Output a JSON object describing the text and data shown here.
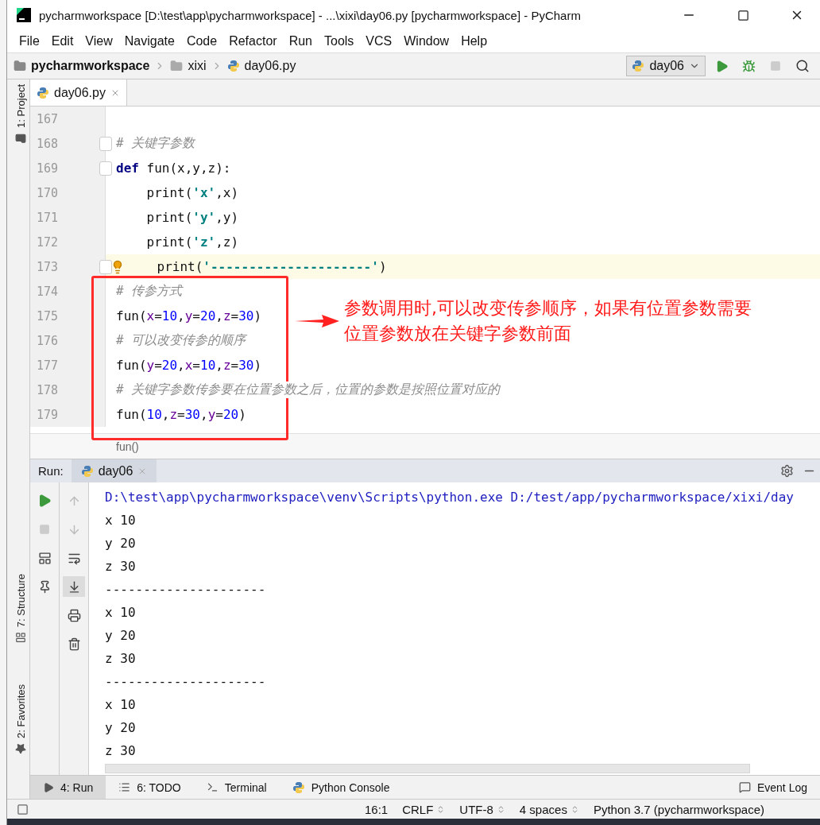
{
  "window": {
    "title": "pycharmworkspace [D:\\test\\app\\pycharmworkspace] - ...\\xixi\\day06.py [pycharmworkspace] - PyCharm"
  },
  "menu": [
    "File",
    "Edit",
    "View",
    "Navigate",
    "Code",
    "Refactor",
    "Run",
    "Tools",
    "VCS",
    "Window",
    "Help"
  ],
  "breadcrumbs": [
    {
      "label": "pycharmworkspace",
      "kind": "project"
    },
    {
      "label": "xixi",
      "kind": "folder"
    },
    {
      "label": "day06.py",
      "kind": "file"
    }
  ],
  "run_config": {
    "label": "day06"
  },
  "editor_tabs": [
    {
      "label": "day06.py",
      "selected": true
    }
  ],
  "side_tools": [
    {
      "label": "1: Project",
      "kind": "project"
    },
    {
      "label": "7: Structure",
      "kind": "structure"
    },
    {
      "label": "2: Favorites",
      "kind": "favorites"
    }
  ],
  "editor": {
    "lines": [
      {
        "number": "167",
        "current": false
      },
      {
        "number": "168",
        "current": false,
        "fold": true,
        "tokens": [
          {
            "text": "# 关键字参数",
            "kind": "comment"
          }
        ]
      },
      {
        "number": "169",
        "current": false,
        "fold": true,
        "tokens": [
          {
            "text": "def",
            "kind": "keyword"
          },
          {
            "text": " fun(x,y,z):",
            "kind": "plain"
          }
        ]
      },
      {
        "number": "170",
        "current": false,
        "tokens": [
          {
            "text": "    print(",
            "kind": "plain"
          },
          {
            "text": "'x'",
            "kind": "string"
          },
          {
            "text": ",x)",
            "kind": "plain"
          }
        ]
      },
      {
        "number": "171",
        "current": false,
        "tokens": [
          {
            "text": "    print(",
            "kind": "plain"
          },
          {
            "text": "'y'",
            "kind": "string"
          },
          {
            "text": ",y)",
            "kind": "plain"
          }
        ]
      },
      {
        "number": "172",
        "current": false,
        "tokens": [
          {
            "text": "    print(",
            "kind": "plain"
          },
          {
            "text": "'z'",
            "kind": "string"
          },
          {
            "text": ",z)",
            "kind": "plain"
          }
        ]
      },
      {
        "number": "173",
        "current": true,
        "fold": true,
        "bulb": true,
        "tokens": [
          {
            "text": "    print(",
            "kind": "plain"
          },
          {
            "text": "'---------------------'",
            "kind": "string"
          },
          {
            "text": ")",
            "kind": "plain"
          }
        ]
      },
      {
        "number": "174",
        "current": false,
        "tokens": [
          {
            "text": "# 传参方式",
            "kind": "comment"
          }
        ]
      },
      {
        "number": "175",
        "current": false,
        "tokens": [
          {
            "text": "fun(",
            "kind": "plain"
          },
          {
            "text": "x",
            "kind": "param"
          },
          {
            "text": "=",
            "kind": "plain"
          },
          {
            "text": "10",
            "kind": "number"
          },
          {
            "text": ",",
            "kind": "plain"
          },
          {
            "text": "y",
            "kind": "param"
          },
          {
            "text": "=",
            "kind": "plain"
          },
          {
            "text": "20",
            "kind": "number"
          },
          {
            "text": ",",
            "kind": "plain"
          },
          {
            "text": "z",
            "kind": "param"
          },
          {
            "text": "=",
            "kind": "plain"
          },
          {
            "text": "30",
            "kind": "number"
          },
          {
            "text": ")",
            "kind": "plain"
          }
        ]
      },
      {
        "number": "176",
        "current": false,
        "tokens": [
          {
            "text": "# 可以改变传参的顺序",
            "kind": "comment"
          }
        ]
      },
      {
        "number": "177",
        "current": false,
        "tokens": [
          {
            "text": "fun(",
            "kind": "plain"
          },
          {
            "text": "y",
            "kind": "param"
          },
          {
            "text": "=",
            "kind": "plain"
          },
          {
            "text": "20",
            "kind": "number"
          },
          {
            "text": ",",
            "kind": "plain"
          },
          {
            "text": "x",
            "kind": "param"
          },
          {
            "text": "=",
            "kind": "plain"
          },
          {
            "text": "10",
            "kind": "number"
          },
          {
            "text": ",",
            "kind": "plain"
          },
          {
            "text": "z",
            "kind": "param"
          },
          {
            "text": "=",
            "kind": "plain"
          },
          {
            "text": "30",
            "kind": "number"
          },
          {
            "text": ")",
            "kind": "plain"
          }
        ]
      },
      {
        "number": "178",
        "current": false,
        "tokens": [
          {
            "text": "# 关键字参数传参要在位置参数之后，位置的参数是按照位置对应的",
            "kind": "comment"
          }
        ]
      },
      {
        "number": "179",
        "current": false,
        "tokens": [
          {
            "text": "fun(",
            "kind": "plain"
          },
          {
            "text": "10",
            "kind": "number"
          },
          {
            "text": ",",
            "kind": "plain"
          },
          {
            "text": "z",
            "kind": "param"
          },
          {
            "text": "=",
            "kind": "plain"
          },
          {
            "text": "30",
            "kind": "number"
          },
          {
            "text": ",",
            "kind": "plain"
          },
          {
            "text": "y",
            "kind": "param"
          },
          {
            "text": "=",
            "kind": "plain"
          },
          {
            "text": "20",
            "kind": "number"
          },
          {
            "text": ")",
            "kind": "plain"
          }
        ]
      }
    ],
    "breadcrumb": "fun()"
  },
  "annotation": {
    "lines": [
      "参数调用时,可以改变传参顺序，如果有位置参数需要",
      "位置参数放在关键字参数前面"
    ]
  },
  "run": {
    "title": "Run:",
    "tabs": [
      {
        "label": "day06",
        "selected": true
      }
    ],
    "output": [
      "D:\\test\\app\\pycharmworkspace\\venv\\Scripts\\python.exe D:/test/app/pycharmworkspace/xixi/day",
      "x 10",
      "y 20",
      "z 30",
      "---------------------",
      "x 10",
      "y 20",
      "z 30",
      "---------------------",
      "x 10",
      "y 20",
      "z 30"
    ]
  },
  "bottom_tabs": [
    {
      "label": "4: Run",
      "kind": "run",
      "selected": true
    },
    {
      "label": "6: TODO",
      "kind": "todo",
      "selected": false
    },
    {
      "label": "Terminal",
      "kind": "terminal",
      "selected": false
    },
    {
      "label": "Python Console",
      "kind": "python",
      "selected": false
    }
  ],
  "event_log": "Event Log",
  "status": [
    "16:1",
    "CRLF",
    "UTF-8",
    "4 spaces",
    "Python 3.7 (pycharmworkspace)"
  ]
}
